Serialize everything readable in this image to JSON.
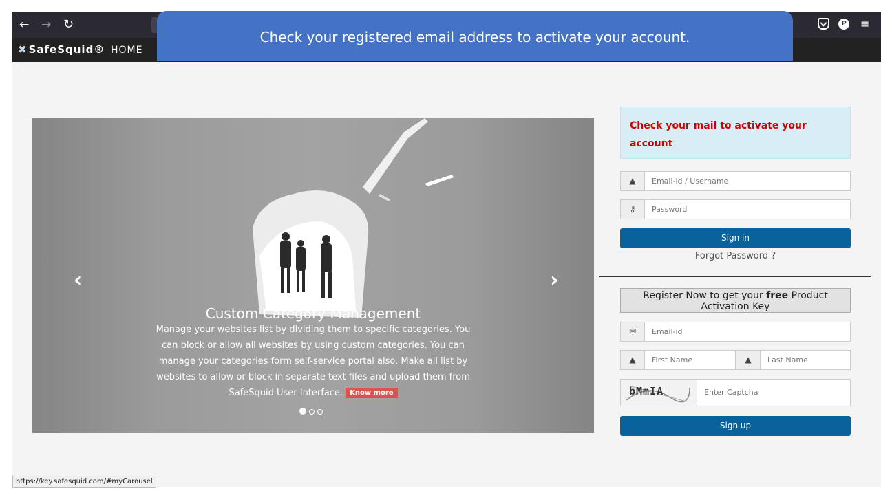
{
  "browser": {
    "back_icon": "←",
    "forward_icon": "→",
    "reload_icon": "C",
    "profile_initial": "P",
    "menu_icon": "≡"
  },
  "site": {
    "logo_text": "SafeSquid®",
    "nav_home": "HOME"
  },
  "banner": {
    "text": "Check your registered email address to activate your account."
  },
  "carousel": {
    "prev_icon": "‹",
    "next_icon": "›",
    "title": "Custom Category Management",
    "description": "Manage your websites list by dividing them to specific categories. You can block or allow all websites by using custom categories. You can manage your categories form self-service portal also. Make all list by websites to allow or block in separate text files and upload them from SafeSquid User Interface.",
    "know_more": "Know more",
    "slide_count": 3,
    "active_slide": 1
  },
  "login": {
    "alert": "Check your mail to activate your account",
    "email_placeholder": "Email-id / Username",
    "password_placeholder": "Password",
    "signin_label": "Sign in",
    "forgot_label": "Forgot Password ?"
  },
  "register": {
    "heading_pre": "Register Now to get your ",
    "heading_bold": "free",
    "heading_post": " Product Activation Key",
    "email_placeholder": "Email-id",
    "first_name_placeholder": "First Name",
    "last_name_placeholder": "Last Name",
    "captcha_text": "bMmIA",
    "captcha_placeholder": "Enter Captcha",
    "signup_label": "Sign up"
  },
  "status_bar": {
    "url": "https://key.safesquid.com/#myCarousel"
  },
  "colors": {
    "banner": "#4472c4",
    "button": "#08629b",
    "alert_text": "#d00000",
    "alert_bg": "#d9edf7",
    "know_more_bg": "#d9534f"
  }
}
